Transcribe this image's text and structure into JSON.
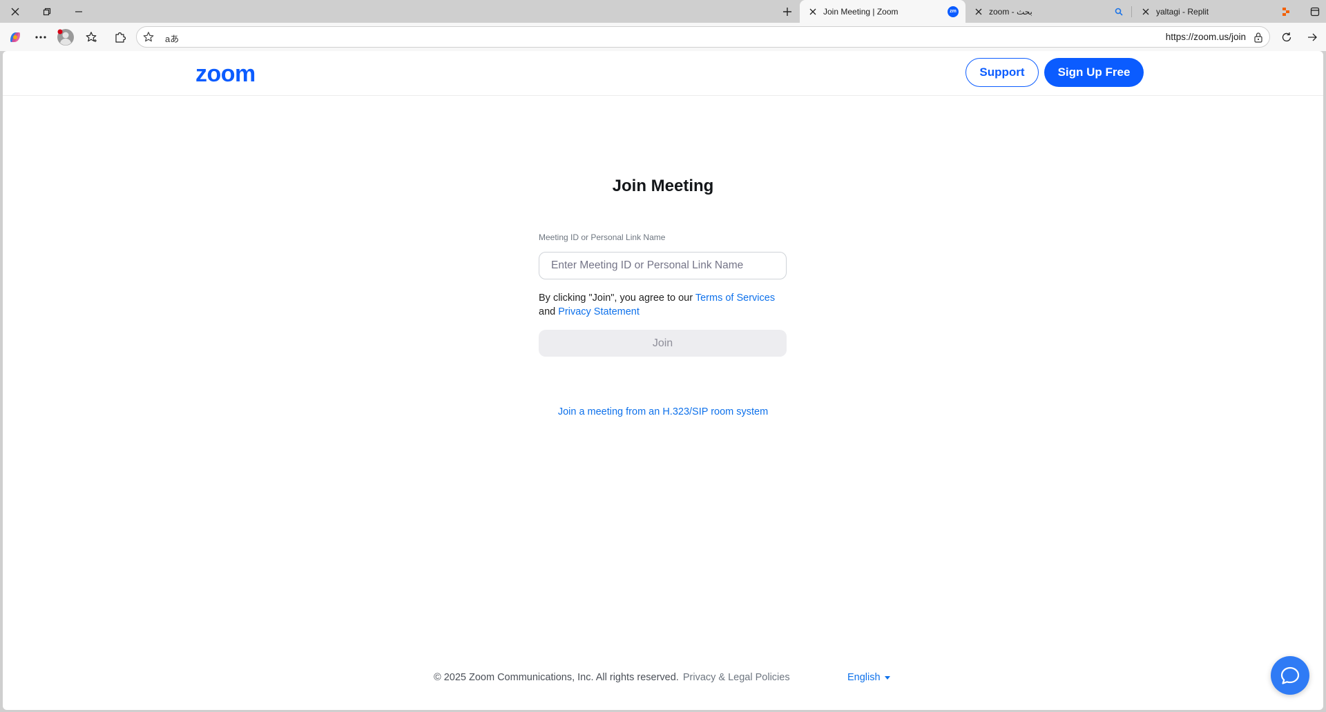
{
  "browser": {
    "tabs": [
      {
        "title": "Join Meeting | Zoom",
        "active": true,
        "favicon": "zoom-favicon"
      },
      {
        "title": "zoom - بحث",
        "active": false,
        "favicon": "search-icon"
      },
      {
        "title": "yaltagi - Replit",
        "active": false,
        "favicon": "replit-favicon"
      }
    ],
    "url": "https://zoom.us/join",
    "read_aloud_label": "aあ"
  },
  "site": {
    "logo": "zoom",
    "support_label": "Support",
    "signup_label": "Sign Up Free"
  },
  "join": {
    "title": "Join Meeting",
    "field_label": "Meeting ID or Personal Link Name",
    "placeholder": "Enter Meeting ID or Personal Link Name",
    "value": "",
    "agree_prefix": "By clicking \"Join\", you agree to our ",
    "terms_link": "Terms of Services",
    "agree_and": "and ",
    "privacy_link": "Privacy Statement",
    "join_label": "Join",
    "sip_link": "Join a meeting from an H.323/SIP room system"
  },
  "footer": {
    "copyright": "© 2025 Zoom Communications, Inc. All rights reserved.",
    "legal_link": "Privacy & Legal Policies",
    "language": "English"
  },
  "colors": {
    "brand": "#0b5cff",
    "link": "#0e71eb",
    "chat": "#2f7bf5"
  }
}
